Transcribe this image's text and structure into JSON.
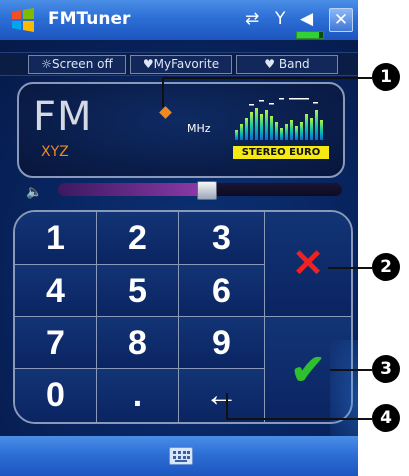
{
  "titlebar": {
    "title": "FMTuner",
    "connectivity_icon": "connectivity-icon",
    "signal_icon": "signal-off-icon",
    "volume_icon": "speaker-icon",
    "close_label": "✕",
    "battery_level": 0.85
  },
  "menu": {
    "screen_off": "☼Screen off",
    "my_favorite": "♥MyFavorite",
    "band": "♥ Band"
  },
  "display": {
    "band": "FM",
    "station": "XYZ",
    "unit": "MHz",
    "stereo_label": "STEREO  EURO"
  },
  "volume": {
    "level": 0.52
  },
  "keypad": {
    "keys": [
      "1",
      "2",
      "3",
      "4",
      "5",
      "6",
      "7",
      "8",
      "9",
      "0",
      ".",
      "←"
    ],
    "cancel_symbol": "✕",
    "confirm_symbol": "✔"
  },
  "callouts": [
    "1",
    "2",
    "3",
    "4"
  ],
  "colors": {
    "accent": "#f08a1e",
    "stereo": "#f5ea12",
    "cancel": "#ee2222",
    "confirm": "#2fc02f"
  }
}
